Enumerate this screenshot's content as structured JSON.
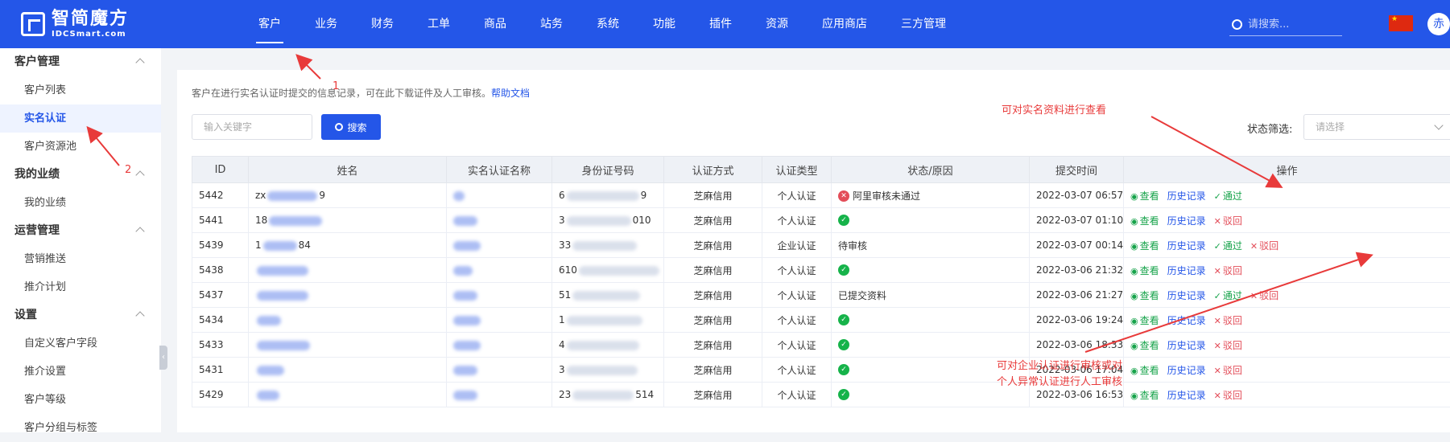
{
  "brand": {
    "name_cn": "智简魔方",
    "name_en": "IDCSmart.com"
  },
  "top_nav": [
    "客户",
    "业务",
    "财务",
    "工单",
    "商品",
    "站务",
    "系统",
    "功能",
    "插件",
    "资源",
    "应用商店",
    "三方管理"
  ],
  "top_search": {
    "placeholder": "请搜索..."
  },
  "avatar_text": "赤",
  "sidebar": [
    {
      "group": "客户管理",
      "items": [
        "客户列表",
        "实名认证",
        "客户资源池"
      ]
    },
    {
      "group": "我的业绩",
      "items": [
        "我的业绩"
      ]
    },
    {
      "group": "运营管理",
      "items": [
        "营销推送",
        "推介计划"
      ]
    },
    {
      "group": "设置",
      "items": [
        "自定义客户字段",
        "推介设置",
        "客户等级",
        "客户分组与标签"
      ]
    }
  ],
  "content": {
    "tip": "客户在进行实名认证时提交的信息记录，可在此下载证件及人工审核。",
    "help_link": "帮助文档",
    "keyword_placeholder": "输入关键字",
    "search_button": "搜索",
    "status_filter_label": "状态筛选:",
    "status_filter_placeholder": "请选择"
  },
  "table": {
    "columns": [
      "ID",
      "姓名",
      "实名认证名称",
      "身份证号码",
      "认证方式",
      "认证类型",
      "状态/原因",
      "提交时间",
      "操作"
    ],
    "rows": [
      {
        "id": "5442",
        "name_prefix": "zx",
        "name_suffix": "9",
        "id_prefix": "6",
        "id_suffix": "9",
        "method": "芝麻信用",
        "type": "个人认证",
        "status": "fail",
        "status_text": "阿里审核未通过",
        "time": "2022-03-07 06:57",
        "ops": [
          "查看",
          "历史记录",
          "通过"
        ]
      },
      {
        "id": "5441",
        "name_prefix": "18",
        "name_suffix": "",
        "id_prefix": "3",
        "id_suffix": "010",
        "method": "芝麻信用",
        "type": "个人认证",
        "status": "ok",
        "status_text": "",
        "time": "2022-03-07 01:10",
        "ops": [
          "查看",
          "历史记录",
          "驳回"
        ]
      },
      {
        "id": "5439",
        "name_prefix": "1",
        "name_suffix": "84",
        "id_prefix": "33",
        "id_suffix": "",
        "method": "芝麻信用",
        "type": "企业认证",
        "status": "text",
        "status_text": "待审核",
        "time": "2022-03-07 00:14",
        "ops": [
          "查看",
          "历史记录",
          "通过",
          "驳回"
        ]
      },
      {
        "id": "5438",
        "name_prefix": "",
        "name_suffix": "",
        "id_prefix": "610",
        "id_suffix": "",
        "method": "芝麻信用",
        "type": "个人认证",
        "status": "ok",
        "status_text": "",
        "time": "2022-03-06 21:32",
        "ops": [
          "查看",
          "历史记录",
          "驳回"
        ]
      },
      {
        "id": "5437",
        "name_prefix": "",
        "name_suffix": "",
        "id_prefix": "51",
        "id_suffix": "",
        "method": "芝麻信用",
        "type": "个人认证",
        "status": "text",
        "status_text": "已提交资料",
        "time": "2022-03-06 21:27",
        "ops": [
          "查看",
          "历史记录",
          "通过",
          "驳回"
        ]
      },
      {
        "id": "5434",
        "name_prefix": "",
        "name_suffix": "",
        "id_prefix": "1",
        "id_suffix": "",
        "method": "芝麻信用",
        "type": "个人认证",
        "status": "ok",
        "status_text": "",
        "time": "2022-03-06 19:24",
        "ops": [
          "查看",
          "历史记录",
          "驳回"
        ]
      },
      {
        "id": "5433",
        "name_prefix": "",
        "name_suffix": "",
        "id_prefix": "4",
        "id_suffix": "",
        "method": "芝麻信用",
        "type": "个人认证",
        "status": "ok",
        "status_text": "",
        "time": "2022-03-06 18:33",
        "ops": [
          "查看",
          "历史记录",
          "驳回"
        ]
      },
      {
        "id": "5431",
        "name_prefix": "",
        "name_suffix": "",
        "id_prefix": "3",
        "id_suffix": "",
        "method": "芝麻信用",
        "type": "个人认证",
        "status": "ok",
        "status_text": "",
        "time": "2022-03-06 17:04",
        "ops": [
          "查看",
          "历史记录",
          "驳回"
        ]
      },
      {
        "id": "5429",
        "name_prefix": "",
        "name_suffix": "",
        "id_prefix": "23",
        "id_suffix": "514",
        "method": "芝麻信用",
        "type": "个人认证",
        "status": "ok",
        "status_text": "",
        "time": "2022-03-06 16:53",
        "ops": [
          "查看",
          "历史记录",
          "驳回"
        ]
      }
    ]
  },
  "annotations": {
    "step1": "1",
    "step2": "2",
    "view_note": "可对实名资料进行查看",
    "review_note_1": "可对企业认证进行审核或对",
    "review_note_2": "个人异常认证进行人工审核"
  },
  "colors": {
    "primary": "#2456e8",
    "success": "#16a34a",
    "danger": "#e34d59",
    "annotation": "#e83a3a"
  }
}
